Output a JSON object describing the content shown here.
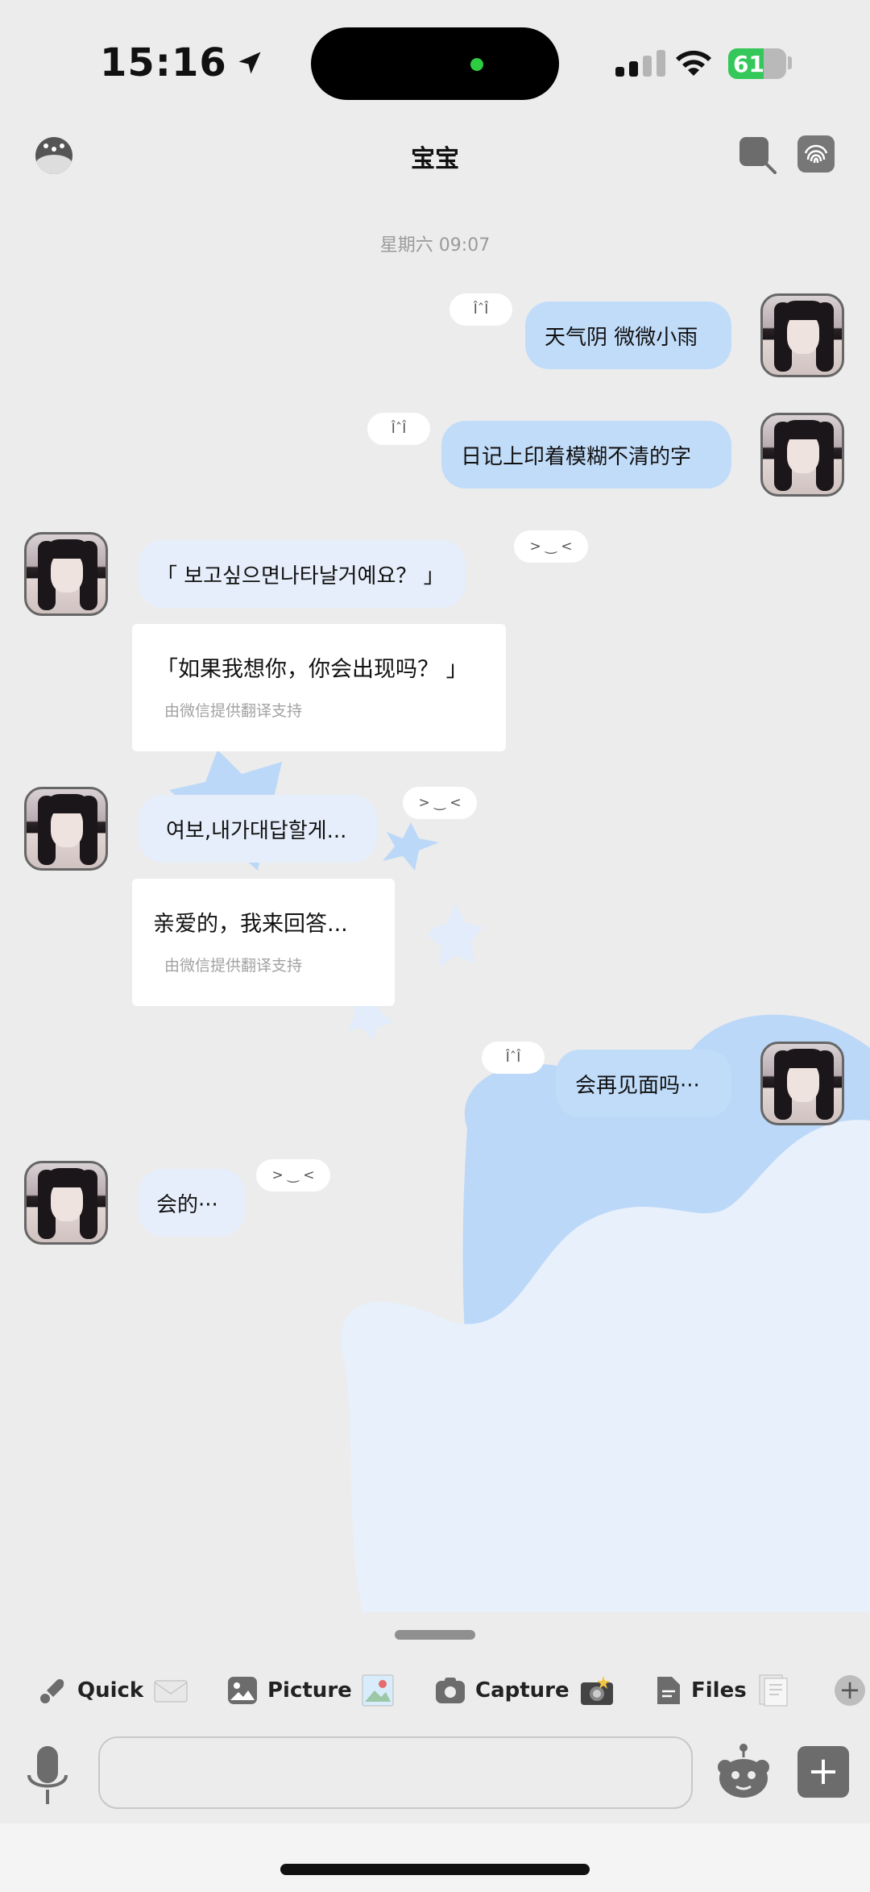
{
  "status_bar": {
    "time": "15:16",
    "battery": "61",
    "battery_level": 0.61
  },
  "header": {
    "title": "宝宝"
  },
  "chat": {
    "time_divider": "星期六 09:07",
    "messages": [
      {
        "text": "天气阴  微微小雨",
        "kaomoji": "ÎˆÎ"
      },
      {
        "text": "日记上印着模糊不清的字",
        "kaomoji": "ÎˆÎ"
      },
      {
        "text": "「  보고싶으면나타날거예요？ 」",
        "kaomoji": "> ‿ <",
        "translation": "「如果我想你，你会出现吗？ 」",
        "translation_note": "由微信提供翻译支持"
      },
      {
        "text": "여보,내가대답할게...",
        "kaomoji": "> ‿ <",
        "translation": "亲爱的，我来回答...",
        "translation_note": "由微信提供翻译支持"
      },
      {
        "text": "会再见面吗···",
        "kaomoji": "ÎˆÎ"
      },
      {
        "text": "会的···",
        "kaomoji": "> ‿ <"
      }
    ]
  },
  "quick_actions": [
    {
      "label": "Quick",
      "icon": "rocket-icon"
    },
    {
      "label": "Picture",
      "icon": "image-icon"
    },
    {
      "label": "Capture",
      "icon": "camera-icon"
    },
    {
      "label": "Files",
      "icon": "file-icon"
    }
  ],
  "input": {
    "placeholder": ""
  },
  "colors": {
    "background": "#ececec",
    "bubble_blue": "#c1dcf9",
    "bubble_lavender": "#e6eefb",
    "deco_blue": "#bcd8f8",
    "deco_light": "#e8f0fc"
  }
}
